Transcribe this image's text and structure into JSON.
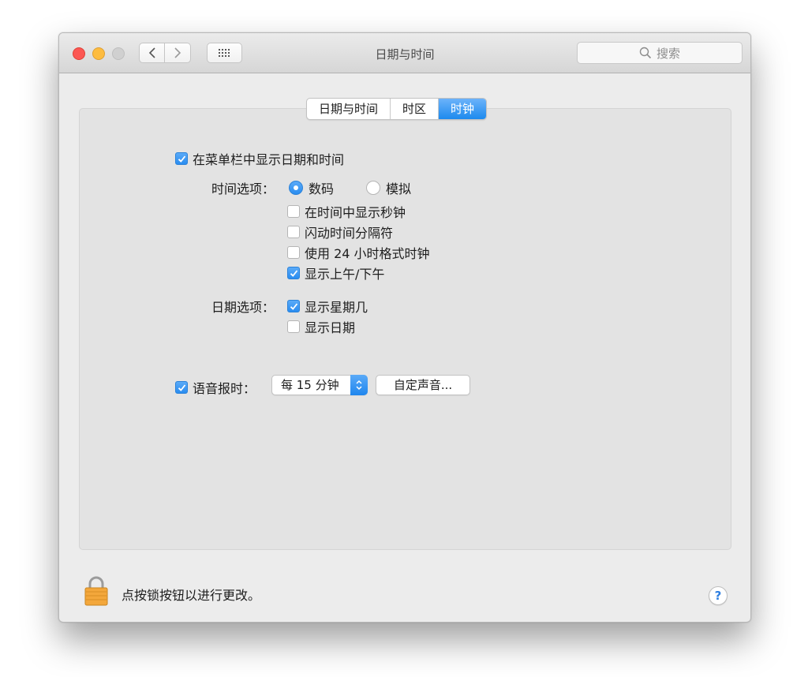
{
  "window": {
    "title": "日期与时间",
    "search_placeholder": "搜索"
  },
  "tabs": [
    {
      "label": "日期与时间",
      "active": false
    },
    {
      "label": "时区",
      "active": false
    },
    {
      "label": "时钟",
      "active": true
    }
  ],
  "clock": {
    "show_in_menubar": {
      "label": "在菜单栏中显示日期和时间",
      "checked": true
    },
    "time_options": {
      "label": "时间选项：",
      "digital": {
        "label": "数码",
        "selected": true
      },
      "analog": {
        "label": "模拟",
        "selected": false
      },
      "show_seconds": {
        "label": "在时间中显示秒钟",
        "checked": false
      },
      "flash_separators": {
        "label": "闪动时间分隔符",
        "checked": false
      },
      "use_24h": {
        "label": "使用 24 小时格式时钟",
        "checked": false
      },
      "show_ampm": {
        "label": "显示上午/下午",
        "checked": true
      }
    },
    "date_options": {
      "label": "日期选项：",
      "show_weekday": {
        "label": "显示星期几",
        "checked": true
      },
      "show_date": {
        "label": "显示日期",
        "checked": false
      }
    },
    "announce": {
      "label": "语音报时：",
      "checked": true,
      "interval": "每 15 分钟",
      "customize_label": "自定声音..."
    }
  },
  "footer": {
    "lock_text": "点按锁按钮以进行更改。",
    "help_label": "?"
  },
  "colors": {
    "accent": "#2a8df0",
    "close": "#fc5753",
    "minimize": "#fdbc40",
    "zoom_disabled": "#d0d0d0"
  }
}
